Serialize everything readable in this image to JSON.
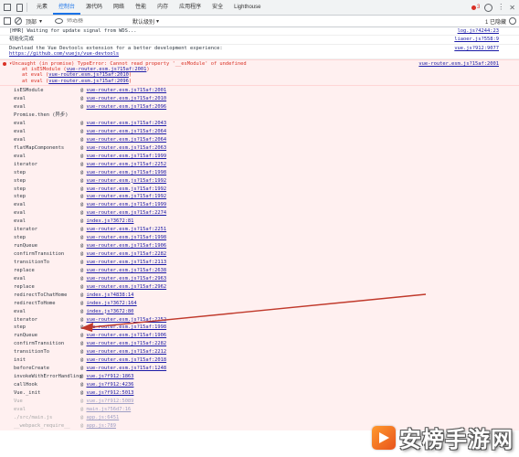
{
  "tabs": [
    "元素",
    "控制台",
    "源代码",
    "网络",
    "性能",
    "内存",
    "应用程序",
    "安全",
    "Lighthouse"
  ],
  "active_tab": "控制台",
  "error_badge": "3",
  "filter": {
    "context": "顶部",
    "placeholder": "筛选器",
    "levels": "默认级别",
    "hidden": "1 已隐藏"
  },
  "messages": [
    {
      "text": "[HMR] Waiting for update signal from WDS...",
      "source": "log.js?4244:23"
    },
    {
      "text": "初始化完成",
      "source": "liaoer.js?558:9"
    },
    {
      "text": "Download the Vue Devtools extension for a better development experience:",
      "link": "https://github.com/vuejs/vue-devtools",
      "source": "vue.js?912:9077"
    }
  ],
  "error": {
    "title": "Uncaught (in promise) TypeError: Cannot read property '__esModule' of undefined",
    "source": "vue-router.esm.js?15af:2001",
    "at_lines": [
      {
        "prefix": "at isESModule (",
        "link": "vue-router.esm.js?15af:2001",
        "suffix": ")"
      },
      {
        "prefix": "at eval (",
        "link": "vue-router.esm.js?15af:2010",
        "suffix": ")"
      },
      {
        "prefix": "at eval (",
        "link": "vue-router.esm.js?15af:2096",
        "suffix": ")"
      }
    ]
  },
  "stack": [
    {
      "fn": "isESModule",
      "loc": "vue-router.esm.js?15af:2001"
    },
    {
      "fn": "eval",
      "loc": "vue-router.esm.js?15af:2010"
    },
    {
      "fn": "eval",
      "loc": "vue-router.esm.js?15af:2096"
    },
    {
      "fn": "Promise.then (异步)",
      "loc": ""
    },
    {
      "fn": "eval",
      "loc": "vue-router.esm.js?15af:2043"
    },
    {
      "fn": "eval",
      "loc": "vue-router.esm.js?15af:2064"
    },
    {
      "fn": "eval",
      "loc": "vue-router.esm.js?15af:2064"
    },
    {
      "fn": "flatMapComponents",
      "loc": "vue-router.esm.js?15af:2063"
    },
    {
      "fn": "eval",
      "loc": "vue-router.esm.js?15af:1999"
    },
    {
      "fn": "iterator",
      "loc": "vue-router.esm.js?15af:2252"
    },
    {
      "fn": "step",
      "loc": "vue-router.esm.js?15af:1998"
    },
    {
      "fn": "step",
      "loc": "vue-router.esm.js?15af:1992"
    },
    {
      "fn": "step",
      "loc": "vue-router.esm.js?15af:1992"
    },
    {
      "fn": "step",
      "loc": "vue-router.esm.js?15af:1992"
    },
    {
      "fn": "eval",
      "loc": "vue-router.esm.js?15af:1999"
    },
    {
      "fn": "eval",
      "loc": "vue-router.esm.js?15af:2274"
    },
    {
      "fn": "eval",
      "loc": "index.js?3672:81"
    },
    {
      "fn": "iterator",
      "loc": "vue-router.esm.js?15af:2251"
    },
    {
      "fn": "step",
      "loc": "vue-router.esm.js?15af:1998"
    },
    {
      "fn": "runQueue",
      "loc": "vue-router.esm.js?15af:1906"
    },
    {
      "fn": "confirmTransition",
      "loc": "vue-router.esm.js?15af:2282"
    },
    {
      "fn": "transitionTo",
      "loc": "vue-router.esm.js?15af:2113"
    },
    {
      "fn": "replace",
      "loc": "vue-router.esm.js?15af:2638"
    },
    {
      "fn": "eval",
      "loc": "vue-router.esm.js?15af:2963"
    },
    {
      "fn": "replace",
      "loc": "vue-router.esm.js?15af:2962"
    },
    {
      "fn": "redirectToChatHome",
      "loc": "index.js?4838:14"
    },
    {
      "fn": "redirectToHome",
      "loc": "index.js?3672:164"
    },
    {
      "fn": "eval",
      "loc": "index.js?3672:80"
    },
    {
      "fn": "iterator",
      "loc": "vue-router.esm.js?15af:2252"
    },
    {
      "fn": "step",
      "loc": "vue-router.esm.js?15af:1998"
    },
    {
      "fn": "runQueue",
      "loc": "vue-router.esm.js?15af:1906"
    },
    {
      "fn": "confirmTransition",
      "loc": "vue-router.esm.js?15af:2282"
    },
    {
      "fn": "transitionTo",
      "loc": "vue-router.esm.js?15af:2212"
    },
    {
      "fn": "init",
      "loc": "vue-router.esm.js?15af:2018"
    },
    {
      "fn": "beforeCreate",
      "loc": "vue-router.esm.js?15af:1248"
    },
    {
      "fn": "invokeWithErrorHandling",
      "loc": "vue.js?f912:1863"
    },
    {
      "fn": "callHook",
      "loc": "vue.js?f912:4236"
    },
    {
      "fn": "Vue._init",
      "loc": "vue.js?f912:5013"
    },
    {
      "fn": "Vue",
      "loc": "vue.js?f912:5089",
      "faded": true
    },
    {
      "fn": "eval",
      "loc": "main.js?56d7:16",
      "faded": true
    },
    {
      "fn": "./src/main.js",
      "loc": "app.js:6451",
      "faded": true
    },
    {
      "fn": "__webpack_require__",
      "loc": "app.js:789",
      "faded": true
    }
  ],
  "watermark": {
    "text": "安榜手游网",
    "icon": "play-logo-icon"
  }
}
